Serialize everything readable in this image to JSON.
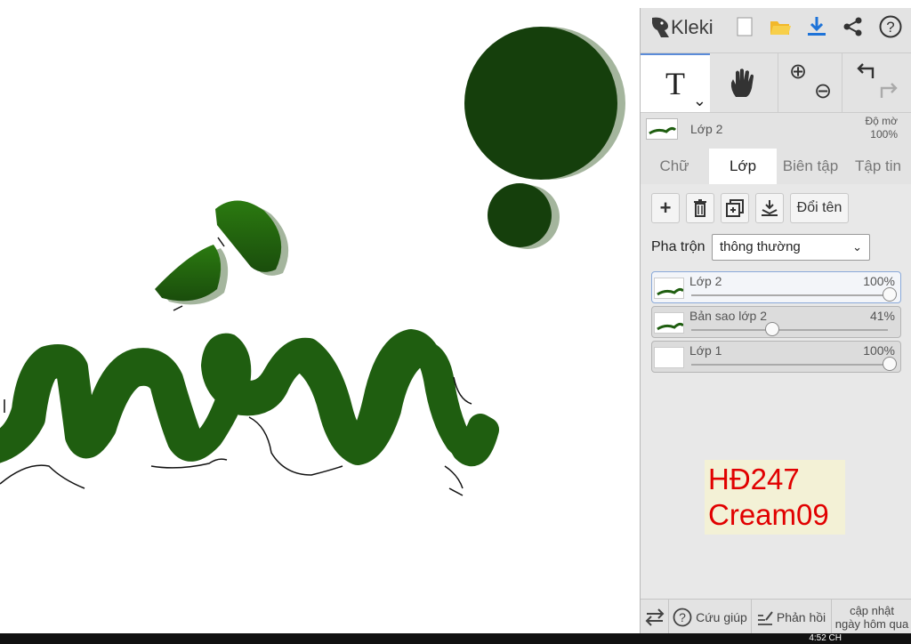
{
  "app": {
    "name": "Kleki"
  },
  "toolbar": {
    "new_icon": "new-file-icon",
    "open_icon": "folder-icon",
    "save_icon": "download-icon",
    "share_icon": "share-icon",
    "help_icon": "help-icon"
  },
  "tools": {
    "text_label": "T",
    "caret": "⌄",
    "hand_icon": "hand-icon",
    "zoom_in": "⊕",
    "zoom_out": "⊖",
    "undo": "⮌",
    "redo": "⮎"
  },
  "layer_header": {
    "name": "Lớp 2",
    "opacity_label": "Độ mờ",
    "opacity_value": "100%"
  },
  "tabs": [
    {
      "label": "Chữ"
    },
    {
      "label": "Lớp"
    },
    {
      "label": "Biên tập"
    },
    {
      "label": "Tập tin"
    }
  ],
  "layer_buttons": {
    "rename_label": "Đổi tên"
  },
  "blend": {
    "label": "Pha trộn",
    "value": "thông thường"
  },
  "layers": [
    {
      "name": "Lớp 2",
      "opacity_text": "100%",
      "opacity": 1.0,
      "selected": true
    },
    {
      "name": "Bản sao lớp 2",
      "opacity_text": "41%",
      "opacity": 0.41,
      "selected": false
    },
    {
      "name": "Lớp 1",
      "opacity_text": "100%",
      "opacity": 1.0,
      "selected": false
    }
  ],
  "watermark": {
    "line1": "HĐ247",
    "line2": "Cream09"
  },
  "bottom": {
    "help_label": "Cứu giúp",
    "feedback_label": "Phản hồi",
    "update_line1": "cập nhật",
    "update_line2": "ngày hôm qua"
  },
  "taskbar": {
    "clock": "4:52 CH"
  },
  "colors": {
    "ink": "#1f5e10",
    "shadow": "#a4b59d",
    "circle": "#153f0c"
  }
}
